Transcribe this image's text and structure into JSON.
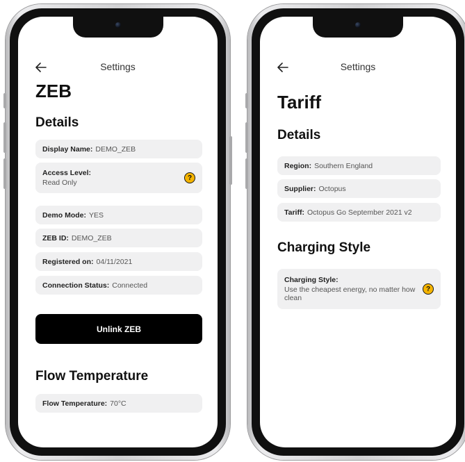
{
  "left_screen": {
    "topbar_title": "Settings",
    "page_title": "ZEB",
    "details_heading": "Details",
    "display_name": {
      "label": "Display Name:",
      "value": "DEMO_ZEB"
    },
    "access_level": {
      "label": "Access Level:",
      "value": "Read Only",
      "help_icon": "?"
    },
    "demo_mode": {
      "label": "Demo Mode:",
      "value": "YES"
    },
    "zeb_id": {
      "label": "ZEB ID:",
      "value": "DEMO_ZEB"
    },
    "registered_on": {
      "label": "Registered on:",
      "value": "04/11/2021"
    },
    "connection_status": {
      "label": "Connection Status:",
      "value": "Connected"
    },
    "unlink_button": "Unlink ZEB",
    "flow_heading": "Flow Temperature",
    "flow_temperature": {
      "label": "Flow Temperature:",
      "value": "70°C"
    }
  },
  "right_screen": {
    "topbar_title": "Settings",
    "page_title": "Tariff",
    "details_heading": "Details",
    "region": {
      "label": "Region:",
      "value": "Southern England"
    },
    "supplier": {
      "label": "Supplier:",
      "value": "Octopus"
    },
    "tariff": {
      "label": "Tariff:",
      "value": "Octopus Go September 2021 v2"
    },
    "charging_heading": "Charging Style",
    "charging_style": {
      "label": "Charging Style:",
      "value": "Use the cheapest energy, no matter how clean",
      "help_icon": "?"
    }
  },
  "colors": {
    "accent_help": "#f5b400",
    "button_bg": "#000000",
    "row_bg": "#f0f0f1"
  },
  "icons": {
    "back": "arrow-left-icon",
    "help": "question-circle-icon"
  }
}
